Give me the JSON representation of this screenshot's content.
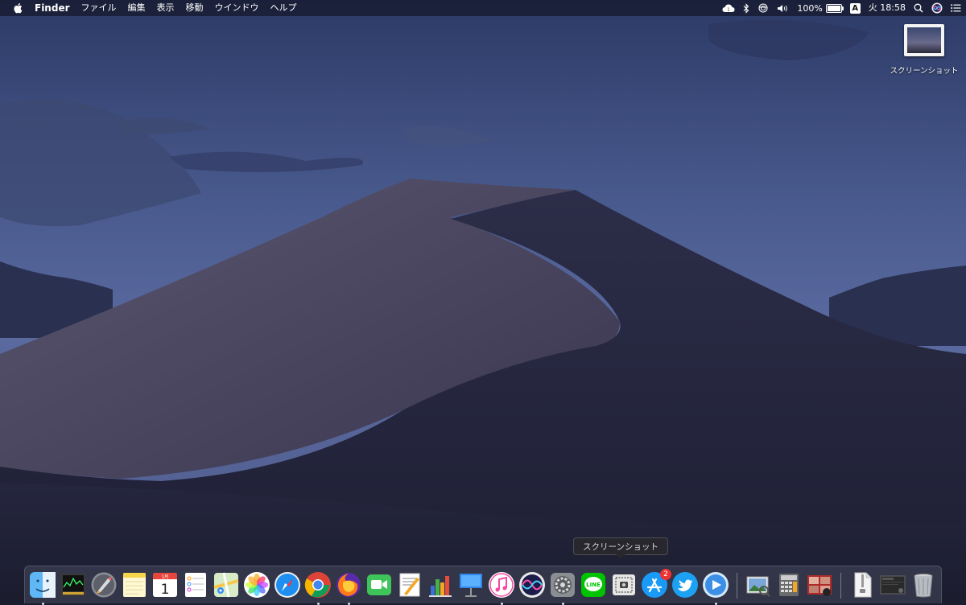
{
  "menubar": {
    "app_name": "Finder",
    "menus": [
      "ファイル",
      "編集",
      "表示",
      "移動",
      "ウインドウ",
      "ヘルプ"
    ],
    "battery_percent": "100%",
    "battery_level": 1.0,
    "input_source": "A",
    "clock": "火 18:58",
    "status_icons": [
      "creative-cloud-icon",
      "bluetooth-icon",
      "airplay-icon",
      "volume-icon",
      "battery-icon",
      "input-source-icon",
      "spotlight-icon",
      "siri-icon",
      "notification-center-icon"
    ]
  },
  "desktop": {
    "icon_label": "スクリーンショット"
  },
  "tooltip": {
    "text": "スクリーンショット"
  },
  "dock": {
    "items": [
      {
        "name": "finder",
        "running": true
      },
      {
        "name": "activity-monitor",
        "running": false
      },
      {
        "name": "launchpad",
        "running": false
      },
      {
        "name": "notes",
        "running": false
      },
      {
        "name": "calendar",
        "running": false,
        "label": "1",
        "month": "1月"
      },
      {
        "name": "reminders",
        "running": false
      },
      {
        "name": "maps",
        "running": false
      },
      {
        "name": "photos",
        "running": false
      },
      {
        "name": "safari",
        "running": false
      },
      {
        "name": "chrome",
        "running": true
      },
      {
        "name": "firefox",
        "running": true
      },
      {
        "name": "facetime",
        "running": false
      },
      {
        "name": "pages",
        "running": false
      },
      {
        "name": "numbers",
        "running": false
      },
      {
        "name": "keynote",
        "running": false
      },
      {
        "name": "itunes",
        "running": true
      },
      {
        "name": "siri",
        "running": false
      },
      {
        "name": "system-preferences",
        "running": true
      },
      {
        "name": "line",
        "running": false,
        "label": "LINE"
      },
      {
        "name": "screenshot",
        "running": false
      },
      {
        "name": "app-store",
        "running": false,
        "badge": "2"
      },
      {
        "name": "twitter",
        "running": false
      },
      {
        "name": "quicktime",
        "running": true
      },
      {
        "name": "preview-stack",
        "running": false
      },
      {
        "name": "calculator-stack",
        "running": false
      },
      {
        "name": "photo-booth-stack",
        "running": false
      },
      {
        "name": "archive-file",
        "running": false
      },
      {
        "name": "screen-recording",
        "running": false
      },
      {
        "name": "trash",
        "running": false
      }
    ]
  }
}
